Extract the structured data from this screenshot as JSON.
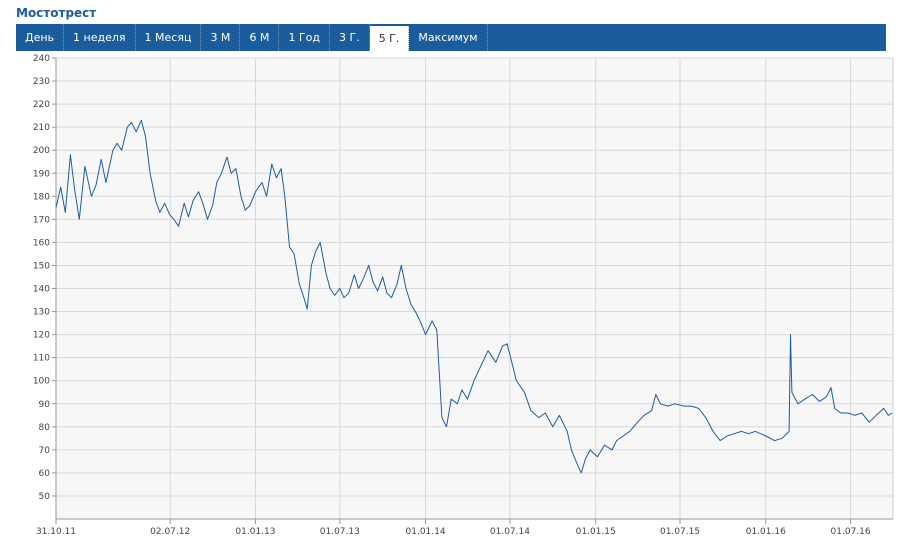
{
  "header": {
    "title": "Мостотрест"
  },
  "tabs": [
    {
      "label": "День",
      "active": false
    },
    {
      "label": "1 неделя",
      "active": false
    },
    {
      "label": "1 Месяц",
      "active": false
    },
    {
      "label": "3 М",
      "active": false
    },
    {
      "label": "6 М",
      "active": false
    },
    {
      "label": "1 Год",
      "active": false
    },
    {
      "label": "3 Г.",
      "active": false
    },
    {
      "label": "5 Г.",
      "active": true
    },
    {
      "label": "Максимум",
      "active": false
    }
  ],
  "colors": {
    "tabbar": "#1b5c9d",
    "line": "#1f5d9e",
    "grid": "#d8d8d8",
    "plot_bg": "#f7f7f7"
  },
  "chart_data": {
    "type": "line",
    "title": "",
    "xlabel": "",
    "ylabel": "",
    "ylim": [
      40,
      240
    ],
    "yticks": [
      50,
      60,
      70,
      80,
      90,
      100,
      110,
      120,
      130,
      140,
      150,
      160,
      170,
      180,
      190,
      200,
      210,
      220,
      230,
      240
    ],
    "xlim": [
      "2011-10-31",
      "2016-09-30"
    ],
    "xticks": [
      {
        "label": "31.10.11",
        "date": "2011-10-31"
      },
      {
        "label": "02.07.12",
        "date": "2012-07-02"
      },
      {
        "label": "01.01.13",
        "date": "2013-01-01"
      },
      {
        "label": "01.07.13",
        "date": "2013-07-01"
      },
      {
        "label": "01.01.14",
        "date": "2014-01-01"
      },
      {
        "label": "01.07.14",
        "date": "2014-07-01"
      },
      {
        "label": "01.01.15",
        "date": "2015-01-01"
      },
      {
        "label": "01.07.15",
        "date": "2015-07-01"
      },
      {
        "label": "01.01.16",
        "date": "2016-01-01"
      },
      {
        "label": "01.07.16",
        "date": "2016-07-01"
      }
    ],
    "grid": true,
    "series": [
      {
        "points": [
          [
            "2011-10-31",
            175
          ],
          [
            "2011-11-10",
            184
          ],
          [
            "2011-11-20",
            173
          ],
          [
            "2011-12-01",
            198
          ],
          [
            "2011-12-10",
            183
          ],
          [
            "2011-12-20",
            170
          ],
          [
            "2012-01-01",
            193
          ],
          [
            "2012-01-15",
            180
          ],
          [
            "2012-01-25",
            185
          ],
          [
            "2012-02-05",
            196
          ],
          [
            "2012-02-15",
            186
          ],
          [
            "2012-03-01",
            200
          ],
          [
            "2012-03-10",
            203
          ],
          [
            "2012-03-20",
            200
          ],
          [
            "2012-04-01",
            210
          ],
          [
            "2012-04-10",
            212
          ],
          [
            "2012-04-20",
            208
          ],
          [
            "2012-05-01",
            213
          ],
          [
            "2012-05-10",
            206
          ],
          [
            "2012-05-20",
            190
          ],
          [
            "2012-06-01",
            178
          ],
          [
            "2012-06-10",
            173
          ],
          [
            "2012-06-20",
            177
          ],
          [
            "2012-07-01",
            172
          ],
          [
            "2012-07-10",
            170
          ],
          [
            "2012-07-20",
            167
          ],
          [
            "2012-08-01",
            177
          ],
          [
            "2012-08-10",
            171
          ],
          [
            "2012-08-20",
            178
          ],
          [
            "2012-09-01",
            182
          ],
          [
            "2012-09-10",
            177
          ],
          [
            "2012-09-20",
            170
          ],
          [
            "2012-10-01",
            176
          ],
          [
            "2012-10-10",
            186
          ],
          [
            "2012-10-20",
            190
          ],
          [
            "2012-11-01",
            197
          ],
          [
            "2012-11-10",
            190
          ],
          [
            "2012-11-20",
            192
          ],
          [
            "2012-12-01",
            180
          ],
          [
            "2012-12-10",
            174
          ],
          [
            "2012-12-20",
            176
          ],
          [
            "2013-01-01",
            182
          ],
          [
            "2013-01-15",
            186
          ],
          [
            "2013-01-25",
            180
          ],
          [
            "2013-02-05",
            194
          ],
          [
            "2013-02-15",
            188
          ],
          [
            "2013-02-25",
            192
          ],
          [
            "2013-03-05",
            180
          ],
          [
            "2013-03-15",
            158
          ],
          [
            "2013-03-25",
            155
          ],
          [
            "2013-04-05",
            142
          ],
          [
            "2013-04-15",
            136
          ],
          [
            "2013-04-22",
            131
          ],
          [
            "2013-05-01",
            150
          ],
          [
            "2013-05-10",
            156
          ],
          [
            "2013-05-20",
            160
          ],
          [
            "2013-06-01",
            147
          ],
          [
            "2013-06-10",
            140
          ],
          [
            "2013-06-20",
            137
          ],
          [
            "2013-07-01",
            140
          ],
          [
            "2013-07-10",
            136
          ],
          [
            "2013-07-20",
            138
          ],
          [
            "2013-08-01",
            146
          ],
          [
            "2013-08-10",
            140
          ],
          [
            "2013-08-20",
            144
          ],
          [
            "2013-09-01",
            150
          ],
          [
            "2013-09-10",
            143
          ],
          [
            "2013-09-20",
            139
          ],
          [
            "2013-10-01",
            145
          ],
          [
            "2013-10-10",
            138
          ],
          [
            "2013-10-20",
            136
          ],
          [
            "2013-11-01",
            142
          ],
          [
            "2013-11-10",
            150
          ],
          [
            "2013-11-20",
            140
          ],
          [
            "2013-12-01",
            133
          ],
          [
            "2013-12-10",
            130
          ],
          [
            "2013-12-20",
            126
          ],
          [
            "2014-01-01",
            120
          ],
          [
            "2014-01-15",
            126
          ],
          [
            "2014-01-25",
            122
          ],
          [
            "2014-02-05",
            84
          ],
          [
            "2014-02-15",
            80
          ],
          [
            "2014-02-25",
            92
          ],
          [
            "2014-03-10",
            90
          ],
          [
            "2014-03-20",
            96
          ],
          [
            "2014-04-01",
            92
          ],
          [
            "2014-04-15",
            100
          ],
          [
            "2014-05-01",
            107
          ],
          [
            "2014-05-15",
            113
          ],
          [
            "2014-06-01",
            108
          ],
          [
            "2014-06-15",
            115
          ],
          [
            "2014-06-25",
            116
          ],
          [
            "2014-07-05",
            108
          ],
          [
            "2014-07-15",
            100
          ],
          [
            "2014-08-01",
            95
          ],
          [
            "2014-08-15",
            87
          ],
          [
            "2014-09-01",
            84
          ],
          [
            "2014-09-15",
            86
          ],
          [
            "2014-10-01",
            80
          ],
          [
            "2014-10-15",
            85
          ],
          [
            "2014-11-01",
            78
          ],
          [
            "2014-11-10",
            70
          ],
          [
            "2014-11-20",
            65
          ],
          [
            "2014-12-01",
            60
          ],
          [
            "2014-12-10",
            66
          ],
          [
            "2014-12-20",
            70
          ],
          [
            "2015-01-05",
            67
          ],
          [
            "2015-01-20",
            72
          ],
          [
            "2015-02-05",
            70
          ],
          [
            "2015-02-15",
            74
          ],
          [
            "2015-03-01",
            76
          ],
          [
            "2015-03-15",
            78
          ],
          [
            "2015-04-01",
            82
          ],
          [
            "2015-04-15",
            85
          ],
          [
            "2015-05-01",
            87
          ],
          [
            "2015-05-10",
            94
          ],
          [
            "2015-05-20",
            90
          ],
          [
            "2015-06-05",
            89
          ],
          [
            "2015-06-20",
            90
          ],
          [
            "2015-07-10",
            89
          ],
          [
            "2015-07-25",
            89
          ],
          [
            "2015-08-10",
            88
          ],
          [
            "2015-08-25",
            84
          ],
          [
            "2015-09-10",
            78
          ],
          [
            "2015-09-25",
            74
          ],
          [
            "2015-10-10",
            76
          ],
          [
            "2015-10-25",
            77
          ],
          [
            "2015-11-10",
            78
          ],
          [
            "2015-11-25",
            77
          ],
          [
            "2015-12-10",
            78
          ],
          [
            "2016-01-01",
            76
          ],
          [
            "2016-01-20",
            74
          ],
          [
            "2016-02-05",
            75
          ],
          [
            "2016-02-20",
            78
          ],
          [
            "2016-02-23",
            120
          ],
          [
            "2016-02-26",
            95
          ],
          [
            "2016-03-10",
            90
          ],
          [
            "2016-03-25",
            92
          ],
          [
            "2016-04-10",
            94
          ],
          [
            "2016-04-25",
            91
          ],
          [
            "2016-05-10",
            93
          ],
          [
            "2016-05-20",
            97
          ],
          [
            "2016-05-28",
            88
          ],
          [
            "2016-06-10",
            86
          ],
          [
            "2016-06-25",
            86
          ],
          [
            "2016-07-10",
            85
          ],
          [
            "2016-07-25",
            86
          ],
          [
            "2016-08-10",
            82
          ],
          [
            "2016-08-25",
            85
          ],
          [
            "2016-09-10",
            88
          ],
          [
            "2016-09-20",
            85
          ],
          [
            "2016-09-28",
            86
          ]
        ]
      }
    ]
  }
}
